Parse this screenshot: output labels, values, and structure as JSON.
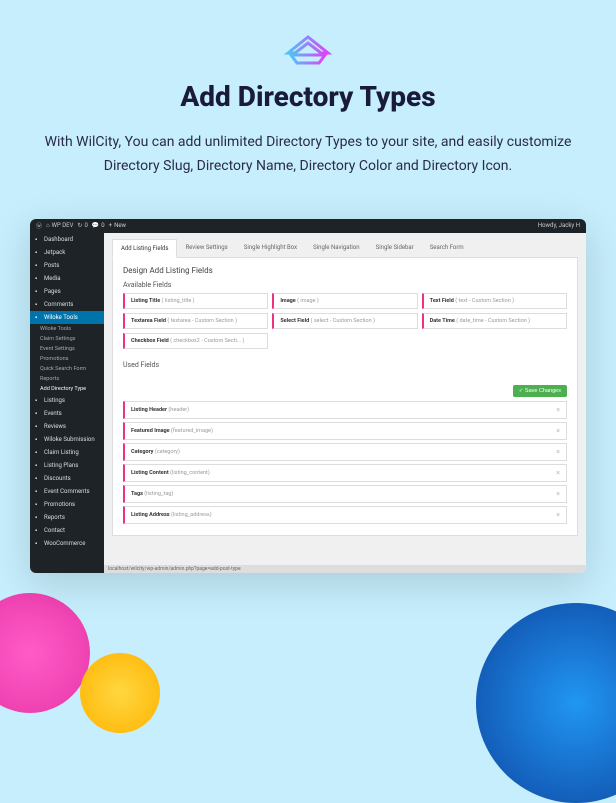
{
  "hero": {
    "title": "Add Directory Types",
    "subtitle": "With WilCity, You can add unlimited Directory Types to your site, and easily customize Directory Slug, Directory Name, Directory Color and Directory Icon."
  },
  "topbar": {
    "site": "WP DEV",
    "updates": "0",
    "comments": "0",
    "new": "New",
    "howdy": "Howdy, Jacky H"
  },
  "sidebar": {
    "items": [
      {
        "label": "Dashboard",
        "icon": "dash"
      },
      {
        "label": "Jetpack",
        "icon": "jet"
      },
      {
        "label": "Posts",
        "icon": "pin"
      },
      {
        "label": "Media",
        "icon": "media"
      },
      {
        "label": "Pages",
        "icon": "page"
      },
      {
        "label": "Comments",
        "icon": "comment"
      },
      {
        "label": "Wiloke Tools",
        "icon": "tools",
        "active": true
      },
      {
        "label": "Listings",
        "icon": "list"
      },
      {
        "label": "Events",
        "icon": "cal"
      },
      {
        "label": "Reviews",
        "icon": "star"
      },
      {
        "label": "Wiloke Submission",
        "icon": "sub"
      },
      {
        "label": "Claim Listing",
        "icon": "claim"
      },
      {
        "label": "Listing Plans",
        "icon": "cart"
      },
      {
        "label": "Discounts",
        "icon": "disc"
      },
      {
        "label": "Event Comments",
        "icon": "ec"
      },
      {
        "label": "Promotions",
        "icon": "promo"
      },
      {
        "label": "Reports",
        "icon": "rep"
      },
      {
        "label": "Contact",
        "icon": "mail"
      },
      {
        "label": "WooCommerce",
        "icon": "woo"
      }
    ],
    "sub": [
      {
        "label": "Wiloke Tools"
      },
      {
        "label": "Claim Settings"
      },
      {
        "label": "Event Settings"
      },
      {
        "label": "Promotions"
      },
      {
        "label": "Quick Search Form"
      },
      {
        "label": "Reports"
      },
      {
        "label": "Add Directory Type",
        "current": true
      }
    ]
  },
  "tabs": [
    {
      "label": "Add Listing Fields",
      "active": true
    },
    {
      "label": "Review Settings"
    },
    {
      "label": "Single Highlight Box"
    },
    {
      "label": "Single Navigation"
    },
    {
      "label": "Single Sidebar"
    },
    {
      "label": "Search Form"
    }
  ],
  "design": {
    "heading": "Design Add Listing Fields",
    "available_label": "Available Fields",
    "used_label": "Used Fields",
    "save_label": "Save Changes"
  },
  "available_fields": [
    {
      "name": "Listing Title",
      "slug": "( listing_title )"
    },
    {
      "name": "Image",
      "slug": "( image )"
    },
    {
      "name": "Text Field",
      "slug": "( text - Custom Section )"
    },
    {
      "name": "Textarea Field",
      "slug": "( textarea - Custom Section )"
    },
    {
      "name": "Select Field",
      "slug": "( select - Custom Section )"
    },
    {
      "name": "Date Time",
      "slug": "( date_time - Custom Section )"
    },
    {
      "name": "Checkbox Field",
      "slug": "( checkbox2 - Custom Secti... )"
    }
  ],
  "used_fields": [
    {
      "name": "Listing Header",
      "slug": "(header)"
    },
    {
      "name": "Featured Image",
      "slug": "(featured_image)"
    },
    {
      "name": "Category",
      "slug": "(category)"
    },
    {
      "name": "Listing Content",
      "slug": "(listing_content)"
    },
    {
      "name": "Tags",
      "slug": "(listing_tag)"
    },
    {
      "name": "Listing Address",
      "slug": "(listing_address)"
    }
  ],
  "statusbar": "localhost/wilcity/wp-admin/admin.php?page=add-post-type",
  "icons": {
    "check": "✓",
    "close": "×",
    "plus": "+"
  }
}
